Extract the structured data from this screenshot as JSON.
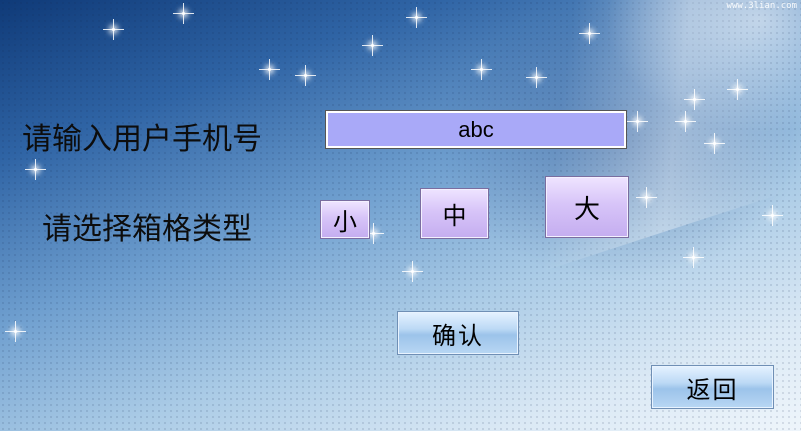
{
  "watermark": "www.3lian.com",
  "form": {
    "phone_label": "请输入用户手机号",
    "phone_value": "abc",
    "type_label": "请选择箱格类型"
  },
  "size_options": {
    "small": "小",
    "medium": "中",
    "large": "大"
  },
  "actions": {
    "confirm_label": "确认",
    "back_label": "返回"
  },
  "colors": {
    "input_bg": "#a9a9f8",
    "size_button_bg": "#d7c4f8",
    "action_button_bg": "#bcd9f5"
  }
}
